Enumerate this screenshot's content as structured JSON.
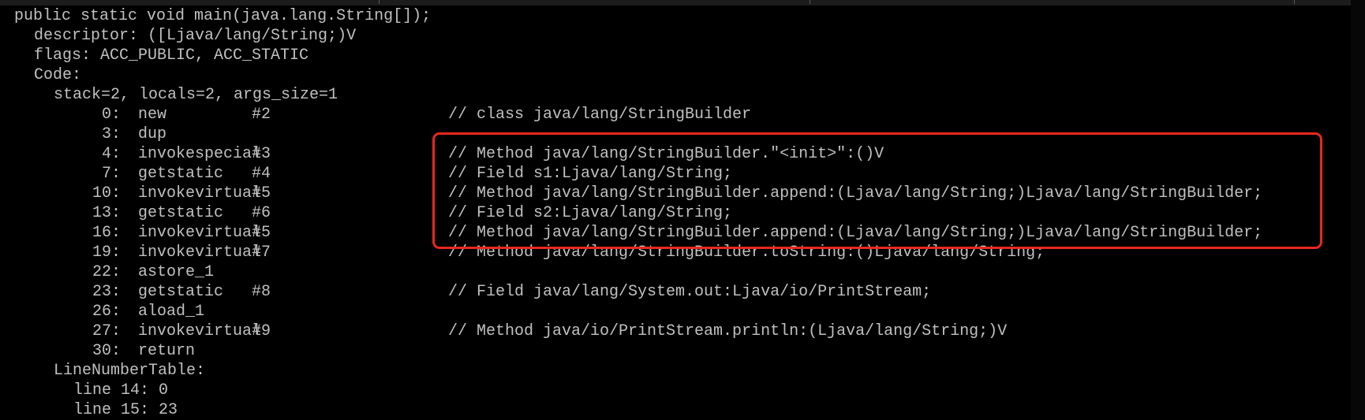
{
  "console": {
    "header": {
      "signature": "public static void main(java.lang.String[]);",
      "descriptor": "descriptor: ([Ljava/lang/String;)V",
      "flags": "flags: ACC_PUBLIC, ACC_STATIC",
      "code": "Code:",
      "stack": "stack=2, locals=2, args_size=1"
    },
    "instructions": [
      {
        "offset": "0:",
        "opcode": "new",
        "operand": "#2",
        "comment": "// class java/lang/StringBuilder"
      },
      {
        "offset": "3:",
        "opcode": "dup",
        "operand": "",
        "comment": ""
      },
      {
        "offset": "4:",
        "opcode": "invokespecial",
        "operand": "#3",
        "comment": "// Method java/lang/StringBuilder.\"<init>\":()V"
      },
      {
        "offset": "7:",
        "opcode": "getstatic",
        "operand": "#4",
        "comment": "// Field s1:Ljava/lang/String;"
      },
      {
        "offset": "10:",
        "opcode": "invokevirtual",
        "operand": "#5",
        "comment": "// Method java/lang/StringBuilder.append:(Ljava/lang/String;)Ljava/lang/StringBuilder;"
      },
      {
        "offset": "13:",
        "opcode": "getstatic",
        "operand": "#6",
        "comment": "// Field s2:Ljava/lang/String;"
      },
      {
        "offset": "16:",
        "opcode": "invokevirtual",
        "operand": "#5",
        "comment": "// Method java/lang/StringBuilder.append:(Ljava/lang/String;)Ljava/lang/StringBuilder;"
      },
      {
        "offset": "19:",
        "opcode": "invokevirtual",
        "operand": "#7",
        "comment": "// Method java/lang/StringBuilder.toString:()Ljava/lang/String;"
      },
      {
        "offset": "22:",
        "opcode": "astore_1",
        "operand": "",
        "comment": ""
      },
      {
        "offset": "23:",
        "opcode": "getstatic",
        "operand": "#8",
        "comment": "// Field java/lang/System.out:Ljava/io/PrintStream;"
      },
      {
        "offset": "26:",
        "opcode": "aload_1",
        "operand": "",
        "comment": ""
      },
      {
        "offset": "27:",
        "opcode": "invokevirtual",
        "operand": "#9",
        "comment": "// Method java/io/PrintStream.println:(Ljava/lang/String;)V"
      },
      {
        "offset": "30:",
        "opcode": "return",
        "operand": "",
        "comment": ""
      }
    ],
    "line_number_table": {
      "title": "LineNumberTable:",
      "entries": [
        "line 14: 0",
        "line 15: 23"
      ]
    }
  },
  "colors": {
    "background": "#000000",
    "text": "#c0c0c0",
    "highlight_border": "#e8281e"
  }
}
